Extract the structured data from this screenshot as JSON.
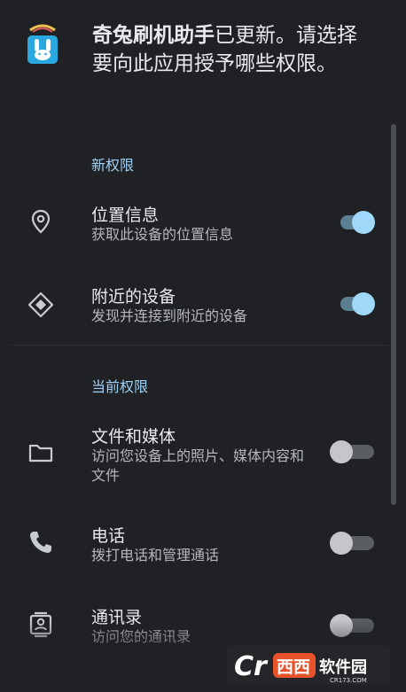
{
  "header": {
    "app_name": "奇兔刷机助手",
    "message": "已更新。请选择要向此应用授予哪些权限。"
  },
  "sections": {
    "new_title": "新权限",
    "current_title": "当前权限"
  },
  "permissions": [
    {
      "title": "位置信息",
      "desc": "获取此设备的位置信息",
      "icon": "location-pin-icon",
      "enabled": true
    },
    {
      "title": "附近的设备",
      "desc": "发现并连接到附近的设备",
      "icon": "nearby-devices-icon",
      "enabled": true
    },
    {
      "title": "文件和媒体",
      "desc": "访问您设备上的照片、媒体内容和文件",
      "icon": "folder-icon",
      "enabled": false
    },
    {
      "title": "电话",
      "desc": "拨打电话和管理通话",
      "icon": "phone-icon",
      "enabled": false
    },
    {
      "title": "通讯录",
      "desc": "访问您的通讯录",
      "icon": "contacts-icon",
      "enabled": false
    }
  ],
  "watermark": {
    "text": "西西软件园",
    "sub": "CR173.COM"
  },
  "colors": {
    "background": "#1f2124",
    "accent": "#9fd8f8",
    "section_title": "#9fd0f5"
  }
}
